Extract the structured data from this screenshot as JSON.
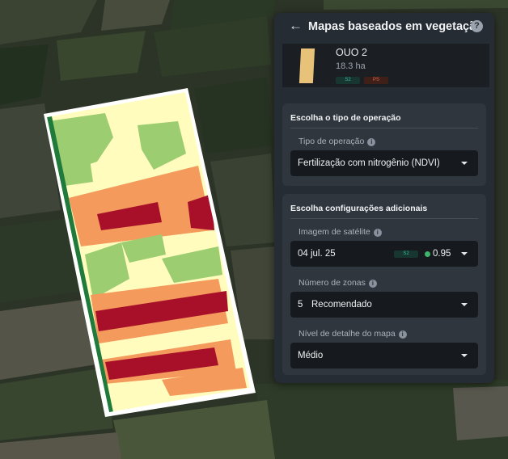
{
  "panel": {
    "back_icon": "arrow-left-icon",
    "title": "Mapas baseados em vegetação",
    "help_icon": "question-icon",
    "help_glyph": "?"
  },
  "field": {
    "name": "OUO 2",
    "area": "18.3 ha",
    "badges": [
      "S2",
      "PS"
    ],
    "thumbnail_color": "#e9c27a"
  },
  "operation": {
    "section_title": "Escolha o tipo de operação",
    "label": "Tipo de operação",
    "value": "Fertilização com nitrogênio (NDVI)"
  },
  "settings": {
    "section_title": "Escolha configurações adicionais",
    "satellite": {
      "label": "Imagem de satélite",
      "date": "04 jul. 25",
      "source_badge": "S2",
      "ndvi": "0.95",
      "status_color": "#3fb36a"
    },
    "zones": {
      "label": "Número de zonas",
      "count": "5",
      "note": "Recomendado"
    },
    "detail": {
      "label": "Nível de detalhe do mapa",
      "value": "Médio"
    }
  },
  "zone_colors": [
    "#a8102a",
    "#f39a5c",
    "#fffcbd",
    "#9ccd70",
    "#1f7a3c"
  ],
  "map_background": "#2c3327"
}
